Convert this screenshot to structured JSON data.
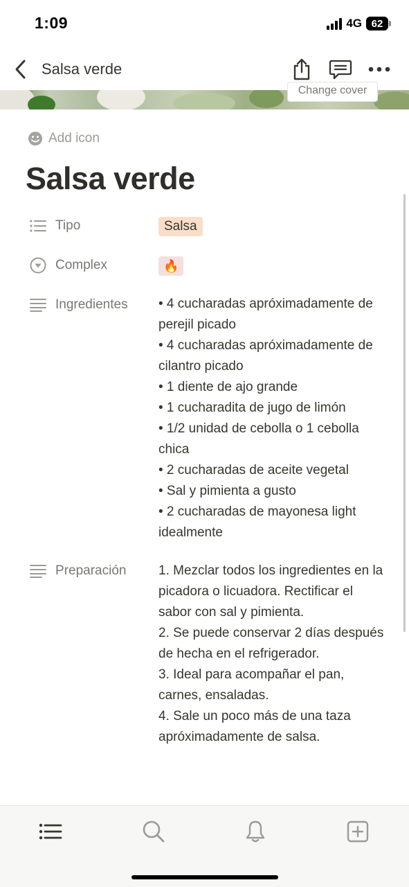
{
  "status_bar": {
    "time": "1:09",
    "network": "4G",
    "battery": "62"
  },
  "nav": {
    "title": "Salsa verde"
  },
  "cover": {
    "change_cover_label": "Change cover"
  },
  "page": {
    "add_icon_label": "Add icon",
    "title": "Salsa verde",
    "properties": {
      "tipo": {
        "label": "Tipo",
        "value": "Salsa",
        "tag_color": "#fadec9"
      },
      "complex": {
        "label": "Complex",
        "value": "🔥",
        "tag_color": "#f4e0de"
      },
      "ingredientes": {
        "label": "Ingredientes",
        "lines": [
          "• 4 cucharadas apróximadamente de perejil picado",
          "• 4 cucharadas apróximadamente de cilantro picado",
          "• 1 diente de ajo grande",
          "• 1 cucharadita de jugo de limón",
          "• 1/2 unidad de cebolla o 1 cebolla chica",
          "• 2 cucharadas de aceite vegetal",
          "• Sal y pimienta a gusto",
          "• 2 cucharadas de mayonesa light idealmente"
        ]
      },
      "preparacion": {
        "label": "Preparación",
        "lines": [
          "1. Mezclar todos los ingredientes en la picadora o licuadora. Rectificar el sabor con sal y pimienta.",
          "2. Se puede conservar 2 días después de hecha en el refrigerador.",
          "3. Ideal para acompañar el pan, carnes, ensaladas.",
          "4. Sale un poco más de una taza apróximadamente de salsa."
        ]
      }
    }
  },
  "bottom_bar": {
    "icons": [
      "list-icon",
      "search-icon",
      "bell-icon",
      "plus-square-icon"
    ]
  }
}
